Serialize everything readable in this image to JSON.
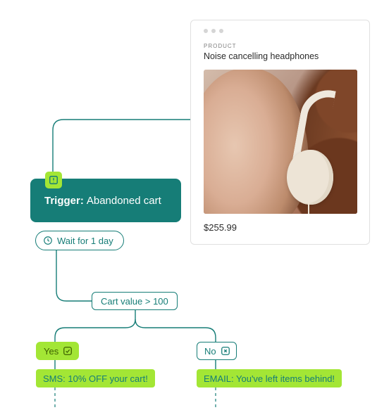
{
  "product": {
    "label": "PRODUCT",
    "name": "Noise cancelling headphones",
    "price": "$255.99"
  },
  "flow": {
    "trigger": {
      "prefix": "Trigger:",
      "label": "Abandoned cart"
    },
    "wait": {
      "label": "Wait for 1 day"
    },
    "condition": {
      "label": "Cart value > 100"
    },
    "branches": {
      "yes": {
        "label": "Yes",
        "action": "SMS: 10% OFF your cart!"
      },
      "no": {
        "label": "No",
        "action": "EMAIL: You've left items behind!"
      }
    }
  },
  "icons": {
    "trigger": "alert-square-icon",
    "wait": "clock-icon",
    "yes": "check-square-icon",
    "no": "x-square-icon"
  },
  "colors": {
    "teal": "#167d77",
    "lime": "#a3e635"
  }
}
